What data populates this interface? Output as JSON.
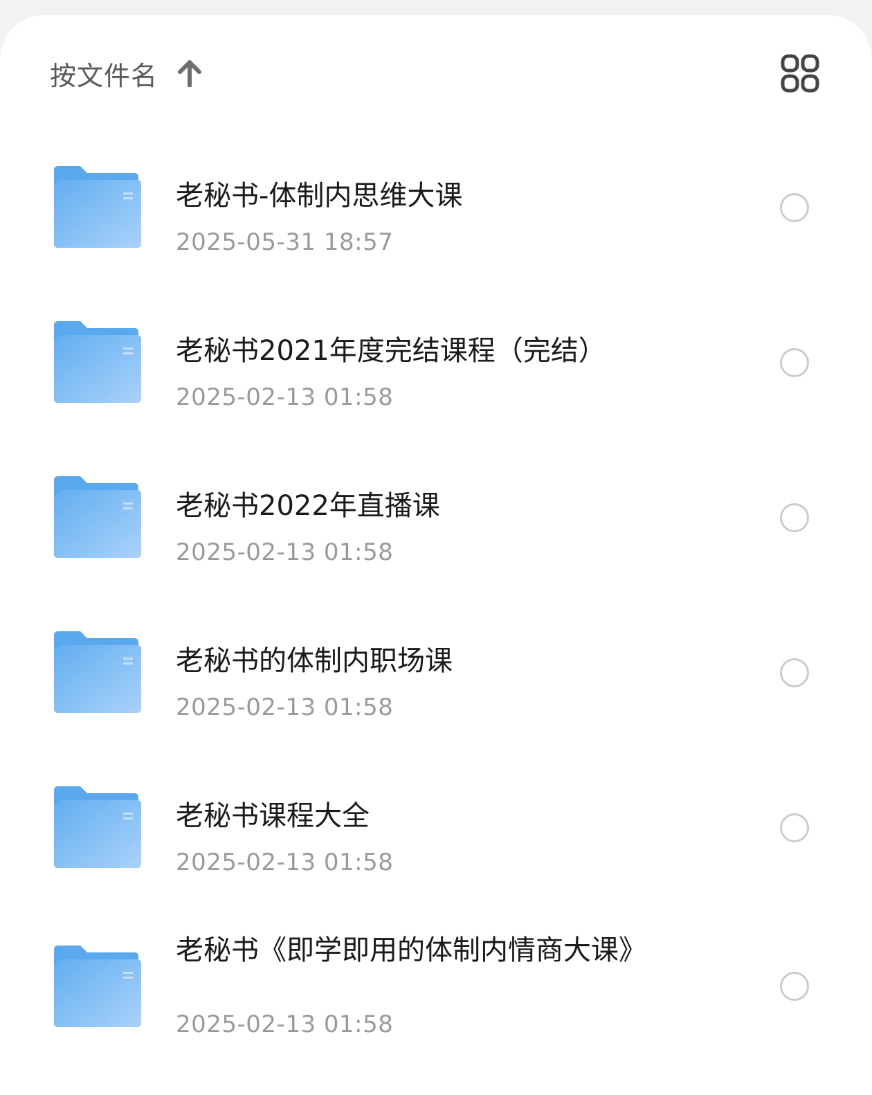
{
  "header": {
    "sort_label": "按文件名",
    "sort_direction_icon": "arrow-up-icon",
    "view_toggle_icon": "grid-view-icon"
  },
  "colors": {
    "folder_blue": "#62aef0",
    "folder_blue_light": "#a9d2fa",
    "text_primary": "#1a1a1a",
    "text_secondary": "#9a9a9a",
    "radio_border": "#cccccc"
  },
  "files": [
    {
      "name": "老秘书-体制内思维大课",
      "date": "2025-05-31 18:57",
      "icon": "folder-icon"
    },
    {
      "name": "老秘书2021年度完结课程（完结）",
      "date": "2025-02-13 01:58",
      "icon": "folder-icon"
    },
    {
      "name": "老秘书2022年直播课",
      "date": "2025-02-13 01:58",
      "icon": "folder-icon"
    },
    {
      "name": "老秘书的体制内职场课",
      "date": "2025-02-13 01:58",
      "icon": "folder-icon"
    },
    {
      "name": "老秘书课程大全",
      "date": "2025-02-13 01:58",
      "icon": "folder-icon"
    },
    {
      "name": "老秘书《即学即用的体制内情商大课》",
      "date": "2025-02-13 01:58",
      "icon": "folder-icon"
    }
  ]
}
